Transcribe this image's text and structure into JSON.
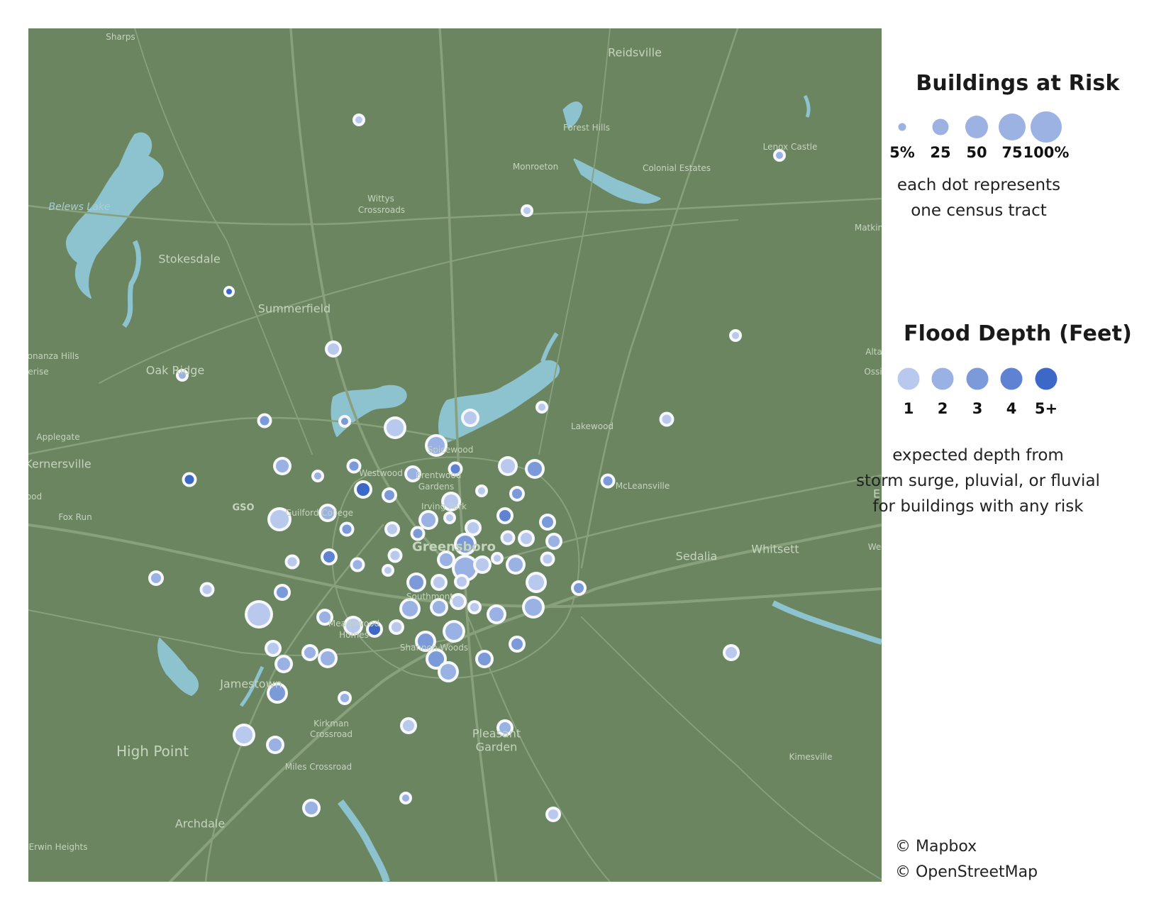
{
  "legend_size": {
    "title": "Buildings at Risk",
    "labels": [
      "5%",
      "25",
      "50",
      "75",
      "100%"
    ],
    "caption_line1": "each dot represents",
    "caption_line2": "one census tract",
    "sample_color": "#9bb2e3"
  },
  "legend_depth": {
    "title": "Flood Depth (Feet)",
    "labels": [
      "1",
      "2",
      "3",
      "4",
      "5+"
    ],
    "colors": [
      "#b9c9ee",
      "#99b1e3",
      "#7c9ad9",
      "#5f83d2",
      "#3e68c7"
    ],
    "caption_line1": "expected depth from",
    "caption_line2": "storm surge, pluvial, or fluvial",
    "caption_line3": "for buildings with any risk"
  },
  "attribution": {
    "line1": "© Mapbox",
    "line2": "© OpenStreetMap"
  },
  "map_colors": {
    "land": "#6b8560",
    "water": "#8cc3cf",
    "road": "#89a07d",
    "label": "#c5d4bd"
  },
  "place_labels": {
    "sharps": "Sharps",
    "reidsville": "Reidsville",
    "forest_hills": "Forest Hills",
    "lenox_castle": "Lenox Castle",
    "monroeton": "Monroeton",
    "colonial_estates": "Colonial Estates",
    "wittys_crossroads_1": "Wittys",
    "wittys_crossroads_2": "Crossroads",
    "belews_lake": "Belews Lake",
    "stokesdale": "Stokesdale",
    "summerfield": "Summerfield",
    "bonanza_hills": "onanza Hills",
    "erise": "erise",
    "oak_ridge": "Oak Ridge",
    "applegate": "Applegate",
    "kernersville": "Kernersville",
    "fox_run": "Fox Run",
    "ood": "ood",
    "gso": "GSO",
    "guilford_college": "Guilford College",
    "westwood": "Westwood",
    "brentwood_gardens_1": "Brentwood",
    "brentwood_gardens_2": "Gardens",
    "spicewood": "Spicewood",
    "irving_park": "Irving Park",
    "greensboro": "Greensboro",
    "lakewood": "Lakewood",
    "mcleansville": "McLeansville",
    "sedalia": "Sedalia",
    "whitsett": "Whitsett",
    "matkins": "Matkin",
    "altamahaw": "Alta",
    "ossipee": "Ossi",
    "e_edge": "E",
    "we_edge": "We",
    "meadowood_homes_1": "Meadowood",
    "meadowood_homes_2": "Homes",
    "southmont": "Southmont",
    "shannon_woods": "Shannon Woods",
    "jamestown": "Jamestown",
    "kirkman_crossroad_1": "Kirkman",
    "kirkman_crossroad_2": "Crossroad",
    "pleasant_garden_1": "Pleasant",
    "pleasant_garden_2": "Garden",
    "high_point": "High Point",
    "kimesville": "Kimesville",
    "miles_crossroad": "Miles Crossroad",
    "archdale": "Archdale",
    "erwin_heights": "Erwin Heights"
  },
  "tracts": [
    {
      "lon": 466,
      "lat": 129,
      "risk": 12,
      "depth": 1
    },
    {
      "lon": 1059,
      "lat": 179,
      "risk": 12,
      "depth": 2
    },
    {
      "lon": 703,
      "lat": 257,
      "risk": 12,
      "depth": 1
    },
    {
      "lon": 283,
      "lat": 371,
      "risk": 10,
      "depth": 5
    },
    {
      "lon": 997,
      "lat": 433,
      "risk": 12,
      "depth": 1
    },
    {
      "lon": 430,
      "lat": 452,
      "risk": 18,
      "depth": 1
    },
    {
      "lon": 217,
      "lat": 489,
      "risk": 12,
      "depth": 2
    },
    {
      "lon": 333,
      "lat": 553,
      "risk": 15,
      "depth": 3
    },
    {
      "lon": 446,
      "lat": 554,
      "risk": 12,
      "depth": 3
    },
    {
      "lon": 724,
      "lat": 534,
      "risk": 12,
      "depth": 1
    },
    {
      "lon": 900,
      "lat": 551,
      "risk": 15,
      "depth": 1
    },
    {
      "lon": 517,
      "lat": 563,
      "risk": 26,
      "depth": 1
    },
    {
      "lon": 623,
      "lat": 549,
      "risk": 20,
      "depth": 1
    },
    {
      "lon": 575,
      "lat": 588,
      "risk": 26,
      "depth": 2
    },
    {
      "lon": 227,
      "lat": 636,
      "risk": 15,
      "depth": 5
    },
    {
      "lon": 358,
      "lat": 617,
      "risk": 20,
      "depth": 2
    },
    {
      "lon": 408,
      "lat": 631,
      "risk": 12,
      "depth": 2
    },
    {
      "lon": 459,
      "lat": 617,
      "risk": 15,
      "depth": 3
    },
    {
      "lon": 542,
      "lat": 628,
      "risk": 18,
      "depth": 2
    },
    {
      "lon": 602,
      "lat": 621,
      "risk": 15,
      "depth": 4
    },
    {
      "lon": 676,
      "lat": 617,
      "risk": 22,
      "depth": 1
    },
    {
      "lon": 714,
      "lat": 621,
      "risk": 22,
      "depth": 3
    },
    {
      "lon": 817,
      "lat": 638,
      "risk": 15,
      "depth": 3
    },
    {
      "lon": 472,
      "lat": 650,
      "risk": 20,
      "depth": 5
    },
    {
      "lon": 509,
      "lat": 658,
      "risk": 16,
      "depth": 3
    },
    {
      "lon": 639,
      "lat": 652,
      "risk": 12,
      "depth": 1
    },
    {
      "lon": 689,
      "lat": 656,
      "risk": 16,
      "depth": 3
    },
    {
      "lon": 596,
      "lat": 667,
      "risk": 22,
      "depth": 1
    },
    {
      "lon": 354,
      "lat": 692,
      "risk": 28,
      "depth": 1
    },
    {
      "lon": 422,
      "lat": 683,
      "risk": 20,
      "depth": 2
    },
    {
      "lon": 449,
      "lat": 706,
      "risk": 15,
      "depth": 3
    },
    {
      "lon": 513,
      "lat": 706,
      "risk": 16,
      "depth": 1
    },
    {
      "lon": 549,
      "lat": 712,
      "risk": 15,
      "depth": 3
    },
    {
      "lon": 564,
      "lat": 693,
      "risk": 22,
      "depth": 2
    },
    {
      "lon": 594,
      "lat": 690,
      "risk": 12,
      "depth": 1
    },
    {
      "lon": 627,
      "lat": 704,
      "risk": 18,
      "depth": 1
    },
    {
      "lon": 672,
      "lat": 687,
      "risk": 18,
      "depth": 4
    },
    {
      "lon": 732,
      "lat": 696,
      "risk": 18,
      "depth": 3
    },
    {
      "lon": 676,
      "lat": 718,
      "risk": 15,
      "depth": 1
    },
    {
      "lon": 702,
      "lat": 719,
      "risk": 18,
      "depth": 1
    },
    {
      "lon": 741,
      "lat": 723,
      "risk": 18,
      "depth": 2
    },
    {
      "lon": 616,
      "lat": 727,
      "risk": 26,
      "depth": 3
    },
    {
      "lon": 424,
      "lat": 745,
      "risk": 18,
      "depth": 4
    },
    {
      "lon": 372,
      "lat": 752,
      "risk": 15,
      "depth": 1
    },
    {
      "lon": 517,
      "lat": 743,
      "risk": 15,
      "depth": 1
    },
    {
      "lon": 464,
      "lat": 756,
      "risk": 15,
      "depth": 2
    },
    {
      "lon": 507,
      "lat": 764,
      "risk": 12,
      "depth": 1
    },
    {
      "lon": 589,
      "lat": 749,
      "risk": 20,
      "depth": 2
    },
    {
      "lon": 616,
      "lat": 761,
      "risk": 32,
      "depth": 2
    },
    {
      "lon": 640,
      "lat": 756,
      "risk": 20,
      "depth": 1
    },
    {
      "lon": 661,
      "lat": 747,
      "risk": 12,
      "depth": 1
    },
    {
      "lon": 687,
      "lat": 756,
      "risk": 22,
      "depth": 2
    },
    {
      "lon": 732,
      "lat": 748,
      "risk": 15,
      "depth": 1
    },
    {
      "lon": 547,
      "lat": 781,
      "risk": 22,
      "depth": 3
    },
    {
      "lon": 579,
      "lat": 781,
      "risk": 18,
      "depth": 1
    },
    {
      "lon": 611,
      "lat": 780,
      "risk": 16,
      "depth": 1
    },
    {
      "lon": 716,
      "lat": 781,
      "risk": 24,
      "depth": 1
    },
    {
      "lon": 180,
      "lat": 775,
      "risk": 16,
      "depth": 2
    },
    {
      "lon": 252,
      "lat": 791,
      "risk": 15,
      "depth": 1
    },
    {
      "lon": 358,
      "lat": 795,
      "risk": 18,
      "depth": 3
    },
    {
      "lon": 776,
      "lat": 789,
      "risk": 16,
      "depth": 3
    },
    {
      "lon": 606,
      "lat": 808,
      "risk": 18,
      "depth": 1
    },
    {
      "lon": 629,
      "lat": 816,
      "risk": 14,
      "depth": 1
    },
    {
      "lon": 579,
      "lat": 816,
      "risk": 20,
      "depth": 2
    },
    {
      "lon": 538,
      "lat": 818,
      "risk": 24,
      "depth": 2
    },
    {
      "lon": 712,
      "lat": 816,
      "risk": 26,
      "depth": 2
    },
    {
      "lon": 660,
      "lat": 826,
      "risk": 22,
      "depth": 2
    },
    {
      "lon": 325,
      "lat": 826,
      "risk": 34,
      "depth": 1
    },
    {
      "lon": 418,
      "lat": 830,
      "risk": 18,
      "depth": 2
    },
    {
      "lon": 458,
      "lat": 842,
      "risk": 22,
      "depth": 1
    },
    {
      "lon": 488,
      "lat": 847,
      "risk": 18,
      "depth": 5
    },
    {
      "lon": 519,
      "lat": 844,
      "risk": 16,
      "depth": 1
    },
    {
      "lon": 600,
      "lat": 850,
      "risk": 26,
      "depth": 2
    },
    {
      "lon": 560,
      "lat": 864,
      "risk": 24,
      "depth": 3
    },
    {
      "lon": 689,
      "lat": 868,
      "risk": 18,
      "depth": 3
    },
    {
      "lon": 345,
      "lat": 874,
      "risk": 18,
      "depth": 1
    },
    {
      "lon": 397,
      "lat": 880,
      "risk": 18,
      "depth": 2
    },
    {
      "lon": 422,
      "lat": 888,
      "risk": 22,
      "depth": 2
    },
    {
      "lon": 360,
      "lat": 896,
      "risk": 20,
      "depth": 2
    },
    {
      "lon": 575,
      "lat": 889,
      "risk": 24,
      "depth": 3
    },
    {
      "lon": 643,
      "lat": 889,
      "risk": 20,
      "depth": 3
    },
    {
      "lon": 592,
      "lat": 907,
      "risk": 24,
      "depth": 2
    },
    {
      "lon": 991,
      "lat": 880,
      "risk": 18,
      "depth": 1
    },
    {
      "lon": 351,
      "lat": 937,
      "risk": 24,
      "depth": 3
    },
    {
      "lon": 446,
      "lat": 944,
      "risk": 14,
      "depth": 2
    },
    {
      "lon": 536,
      "lat": 983,
      "risk": 18,
      "depth": 1
    },
    {
      "lon": 672,
      "lat": 986,
      "risk": 18,
      "depth": 2
    },
    {
      "lon": 304,
      "lat": 996,
      "risk": 26,
      "depth": 1
    },
    {
      "lon": 348,
      "lat": 1010,
      "risk": 20,
      "depth": 2
    },
    {
      "lon": 532,
      "lat": 1085,
      "risk": 12,
      "depth": 2
    },
    {
      "lon": 399,
      "lat": 1099,
      "risk": 20,
      "depth": 2
    },
    {
      "lon": 740,
      "lat": 1108,
      "risk": 16,
      "depth": 1
    }
  ]
}
